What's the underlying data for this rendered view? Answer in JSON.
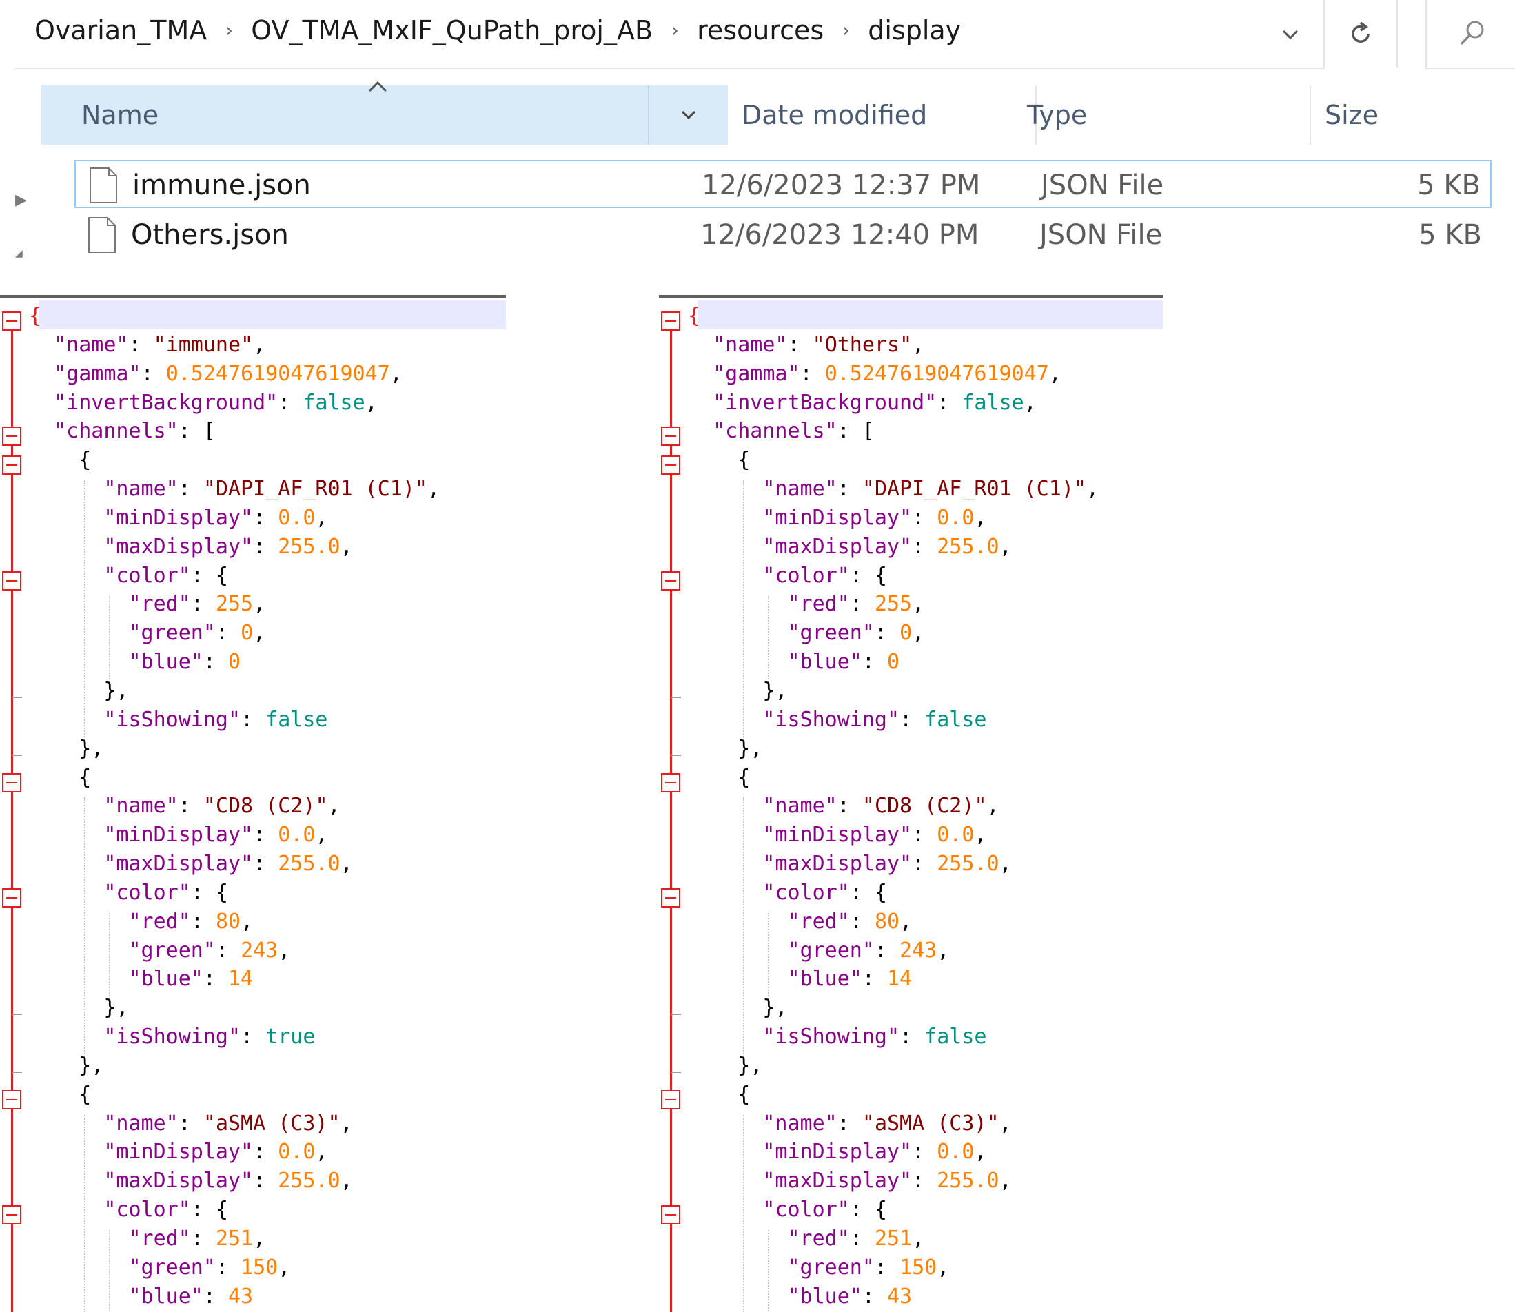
{
  "breadcrumb": [
    "Ovarian_TMA",
    "OV_TMA_MxIF_QuPath_proj_AB",
    "resources",
    "display"
  ],
  "breadcrumb_separator": "›",
  "address_dropdown_icon": "chevron-down-icon",
  "refresh_icon": "refresh-icon",
  "search_icon": "search-icon",
  "columns": {
    "name": "Name",
    "date": "Date modified",
    "type": "Type",
    "size": "Size"
  },
  "files": [
    {
      "name": "immune.json",
      "date": "12/6/2023 12:37 PM",
      "type": "JSON File",
      "size": "5 KB",
      "selected": true
    },
    {
      "name": "Others.json",
      "date": "12/6/2023 12:40 PM",
      "type": "JSON File",
      "size": "5 KB",
      "selected": false
    }
  ],
  "editors": [
    {
      "file": "immune.json",
      "name": "immune",
      "gamma": "0.5247619047619047",
      "invertBackground": "false",
      "channels": [
        {
          "name": "DAPI_AF_R01 (C1)",
          "minDisplay": "0.0",
          "maxDisplay": "255.0",
          "red": "255",
          "green": "0",
          "blue": "0",
          "isShowing": "false"
        },
        {
          "name": "CD8 (C2)",
          "minDisplay": "0.0",
          "maxDisplay": "255.0",
          "red": "80",
          "green": "243",
          "blue": "14",
          "isShowing": "true"
        },
        {
          "name": "aSMA (C3)",
          "minDisplay": "0.0",
          "maxDisplay": "255.0",
          "red": "251",
          "green": "150",
          "blue": "43"
        }
      ]
    },
    {
      "file": "Others.json",
      "name": "Others",
      "gamma": "0.5247619047619047",
      "invertBackground": "false",
      "channels": [
        {
          "name": "DAPI_AF_R01 (C1)",
          "minDisplay": "0.0",
          "maxDisplay": "255.0",
          "red": "255",
          "green": "0",
          "blue": "0",
          "isShowing": "false"
        },
        {
          "name": "CD8 (C2)",
          "minDisplay": "0.0",
          "maxDisplay": "255.0",
          "red": "80",
          "green": "243",
          "blue": "14",
          "isShowing": "false"
        },
        {
          "name": "aSMA (C3)",
          "minDisplay": "0.0",
          "maxDisplay": "255.0",
          "red": "251",
          "green": "150",
          "blue": "43"
        }
      ]
    }
  ],
  "colors": {
    "key": "#880088",
    "string": "#800000",
    "number": "#ff8000",
    "boolean": "#009080",
    "fold_marker": "#e02020"
  }
}
